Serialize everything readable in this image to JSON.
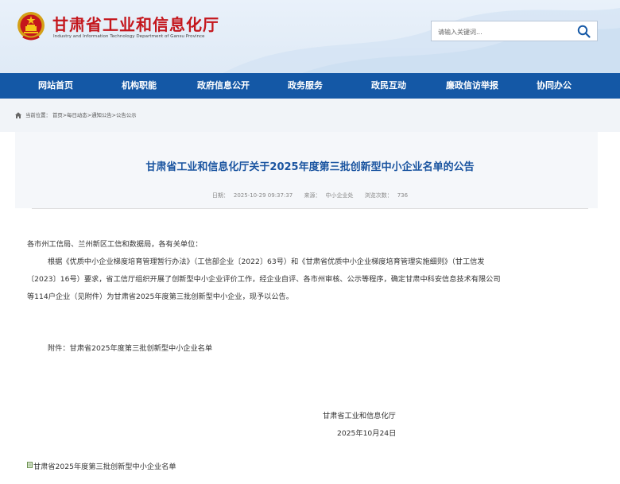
{
  "header": {
    "title": "甘肃省工业和信息化厅",
    "subtitle": "Industry and Information Technology Department of Gansu Province",
    "search_placeholder": "请输入关键词..."
  },
  "nav": {
    "items": [
      {
        "label": "网站首页"
      },
      {
        "label": "机构职能"
      },
      {
        "label": "政府信息公开"
      },
      {
        "label": "政务服务"
      },
      {
        "label": "政民互动"
      },
      {
        "label": "廉政信访举报"
      },
      {
        "label": "协同办公"
      }
    ]
  },
  "breadcrumb": {
    "prefix": "当前位置：",
    "items": [
      "首页",
      "每日动态",
      "通知公告",
      "公告公示"
    ],
    "separator": ">"
  },
  "article": {
    "title": "甘肃省工业和信息化厅关于2025年度第三批创新型中小企业名单的公告",
    "date_label": "日期：",
    "date": "2025-10-29 09:37:37",
    "source_label": "来源：",
    "source": "中小企业处",
    "views_label": "浏览次数：",
    "views": "736",
    "salutation": "各市州工信局、兰州新区工信和数据局，各有关单位：",
    "paragraph": "根据《优质中小企业梯度培育管理暂行办法》（工信部企业〔2022〕63号）和《甘肃省优质中小企业梯度培育管理实施细则》（甘工信发〔2023〕16号）要求，省工信厅组织开展了创新型中小企业评价工作，经企业自评、各市州审核、公示等程序，确定甘肃中科安信息技术有限公司等114户企业（见附件）为甘肃省2025年度第三批创新型中小企业，现予以公告。",
    "paragraph_lines": [
      "根据《优质中小企业梯度培育管理暂行办法》（工信部企业〔2022〕63号）和《甘肃省优质中小企业梯度培育管理实施细则》（甘工信发",
      "〔2023〕16号）要求，省工信厅组织开展了创新型中小企业评价工作，经企业自评、各市州审核、公示等程序，确定甘肃中科安信息技术有限公司",
      "等114户企业（见附件）为甘肃省2025年度第三批创新型中小企业，现予以公告。"
    ],
    "attachment_note": "附件：甘肃省2025年度第三批创新型中小企业名单",
    "signature": "甘肃省工业和信息化厅",
    "sign_date": "2025年10月24日",
    "attachment_link": "甘肃省2025年度第三批创新型中小企业名单"
  },
  "colors": {
    "brand_red": "#c4161c",
    "nav_blue": "#1458a6",
    "title_blue": "#1a54a0"
  }
}
